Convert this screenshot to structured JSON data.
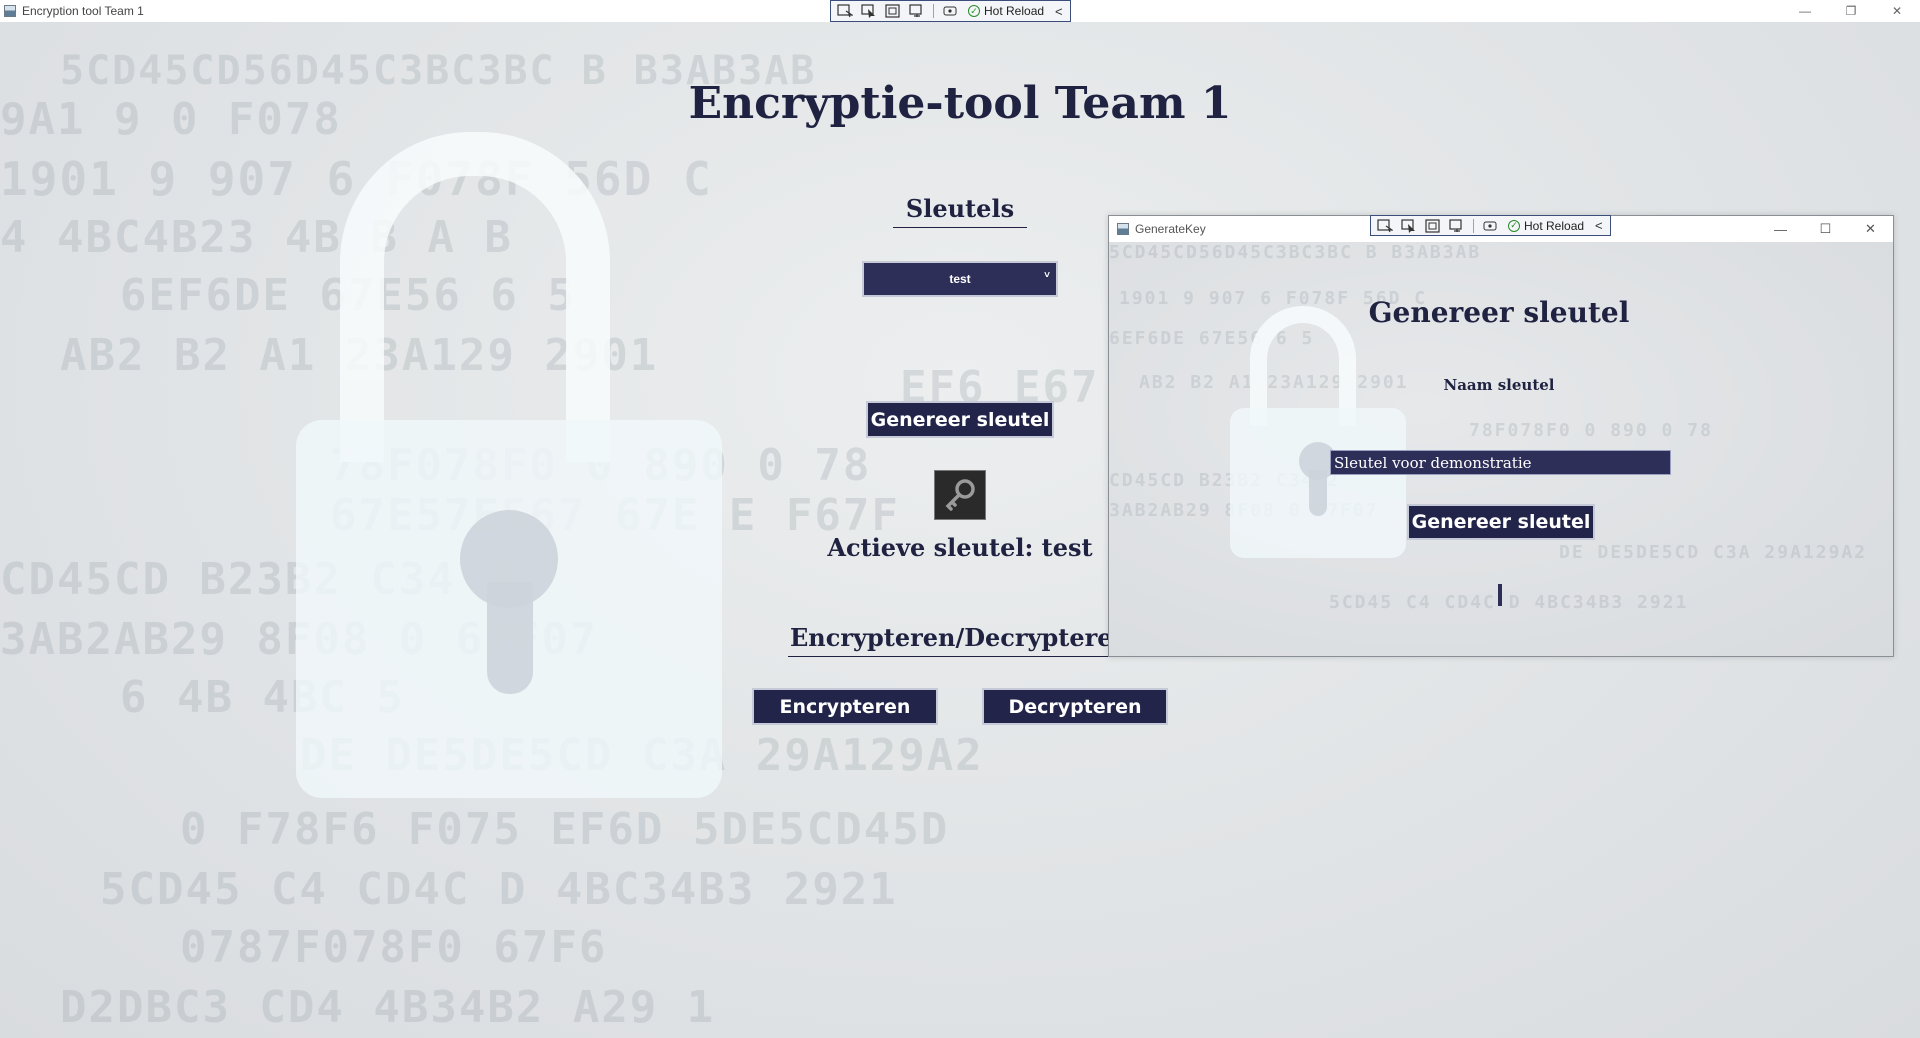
{
  "window": {
    "title": "Encryption tool Team 1",
    "controls": {
      "minimize": "—",
      "restore": "❐",
      "close": "✕"
    }
  },
  "hot_reload_toolbar": {
    "label": "Hot Reload",
    "collapse": "<"
  },
  "main": {
    "title": "Encryptie-tool Team 1",
    "keys_heading": "Sleutels",
    "key_select": {
      "selected": "test",
      "chevron": "˅"
    },
    "generate_button": "Genereer sleutel",
    "key_icon": "key-icon",
    "active_key_text": "Actieve sleutel: test",
    "crypto_heading": "Encrypteren/Decrypteren",
    "encrypt_button": "Encrypteren",
    "decrypt_button": "Decrypteren"
  },
  "generate_window": {
    "title": "GenerateKey",
    "heading": "Genereer sleutel",
    "name_label": "Naam sleutel",
    "name_input_value": "Sleutel voor demonstratie",
    "generate_button": "Genereer sleutel",
    "controls": {
      "minimize": "—",
      "maximize": "☐",
      "close": "✕"
    }
  },
  "background_glyphs": [
    "5CD45CD56D45C3BC3BC B B3AB3AB",
    "9A1   9     0     F078",
    "1901 9 907 6 F078F   56D   C",
    "4  4BC4B23 4B   B A    B",
    "6EF6DE  67E56 6   5",
    "AB2 B2 A1 23A129  2901",
    "78F078F0  0  890  0   78",
    "67E57E567 67E   E   F67F",
    "CD45CD  B23B2 C34 2",
    "3AB2AB29  8F08 0  67F07",
    "6    4B 4BC   5",
    "DE  DE5DE5CD  C3A  29A129A2",
    "0    F78F6 F075    EF6D  5DE5CD45D",
    "5CD45 C4 CD4C  D  4BC34B3   2921",
    "0787F078F0   67F6",
    "D2DBC3 CD4  4B34B2 A29 1",
    "EF6    E67     0"
  ],
  "colors": {
    "accent_dark": "#222549",
    "input_bg": "#2d2f59",
    "title_text": "#1f2240",
    "hot_reload_ok": "#2a8a2a"
  }
}
